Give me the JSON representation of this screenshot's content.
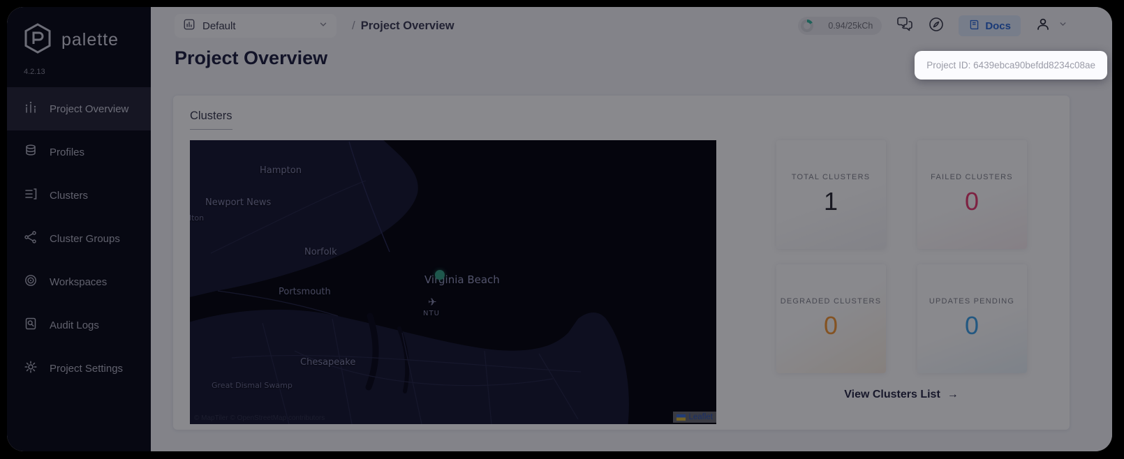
{
  "app": {
    "name": "palette",
    "version": "4.2.13"
  },
  "sidebar": {
    "items": [
      {
        "label": "Project Overview",
        "active": true
      },
      {
        "label": "Profiles",
        "active": false
      },
      {
        "label": "Clusters",
        "active": false
      },
      {
        "label": "Cluster Groups",
        "active": false
      },
      {
        "label": "Workspaces",
        "active": false
      },
      {
        "label": "Audit Logs",
        "active": false
      },
      {
        "label": "Project Settings",
        "active": false
      }
    ]
  },
  "topbar": {
    "project_selector": "Default",
    "breadcrumb_slash": "/",
    "breadcrumb": "Project Overview",
    "usage": "0.94/25kCh",
    "docs_label": "Docs"
  },
  "tooltip": {
    "text": "Project ID: 6439ebca90befdd8234c08ae"
  },
  "page": {
    "title": "Project Overview"
  },
  "clusters_section": {
    "heading": "Clusters",
    "view_list_label": "View Clusters List",
    "arrow": "→",
    "stats": [
      {
        "label": "TOTAL CLUSTERS",
        "value": "1",
        "color": "#2b2b33"
      },
      {
        "label": "FAILED CLUSTERS",
        "value": "0",
        "color": "#e83d71"
      },
      {
        "label": "DEGRADED CLUSTERS",
        "value": "0",
        "color": "#f59a38"
      },
      {
        "label": "UPDATES PENDING",
        "value": "0",
        "color": "#3fa3e8"
      }
    ]
  },
  "map": {
    "labels": [
      "Hampton",
      "Newport News",
      "llton",
      "Norfolk",
      "Virginia Beach",
      "Portsmouth",
      "NTU",
      "Chesapeake",
      "Great Dismal Swamp"
    ],
    "airplane_icon": "✈",
    "marker_color": "#36a184",
    "attribution": "© MapTiler © OpenStreetMap contributors",
    "leaflet_label": "Leaflet"
  }
}
